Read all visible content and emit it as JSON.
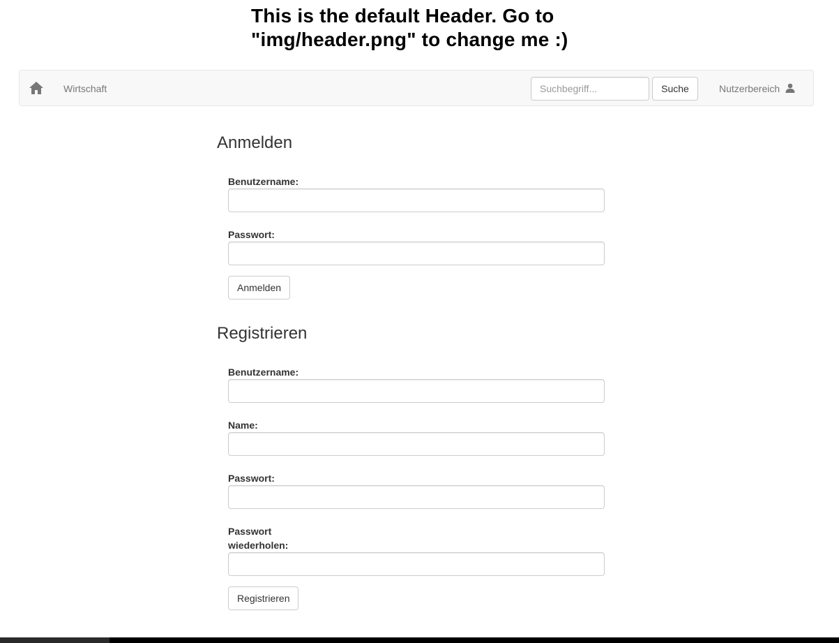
{
  "header": {
    "banner_text": "This is the default Header. Go to \"img/header.png\" to change me :)"
  },
  "navbar": {
    "home_icon": "home-icon",
    "category_link": "Wirtschaft",
    "search_placeholder": "Suchbegriff...",
    "search_value": "",
    "search_button": "Suche",
    "user_area_label": "Nutzerbereich",
    "user_icon": "user-icon"
  },
  "login": {
    "title": "Anmelden",
    "username_label": "Benutzername:",
    "username_value": "",
    "password_label": "Passwort:",
    "password_value": "",
    "submit_label": "Anmelden"
  },
  "register": {
    "title": "Registrieren",
    "username_label": "Benutzername:",
    "username_value": "",
    "name_label": "Name:",
    "name_value": "",
    "password_label": "Passwort:",
    "password_value": "",
    "password_repeat_label_line1": "Passwort",
    "password_repeat_label_line2": "wiederholen:",
    "password_repeat_value": "",
    "submit_label": "Registrieren"
  },
  "colors": {
    "navbar_bg": "#f8f8f8",
    "navbar_border": "#e7e7e7",
    "nav_text": "#777777",
    "text": "#333333"
  }
}
